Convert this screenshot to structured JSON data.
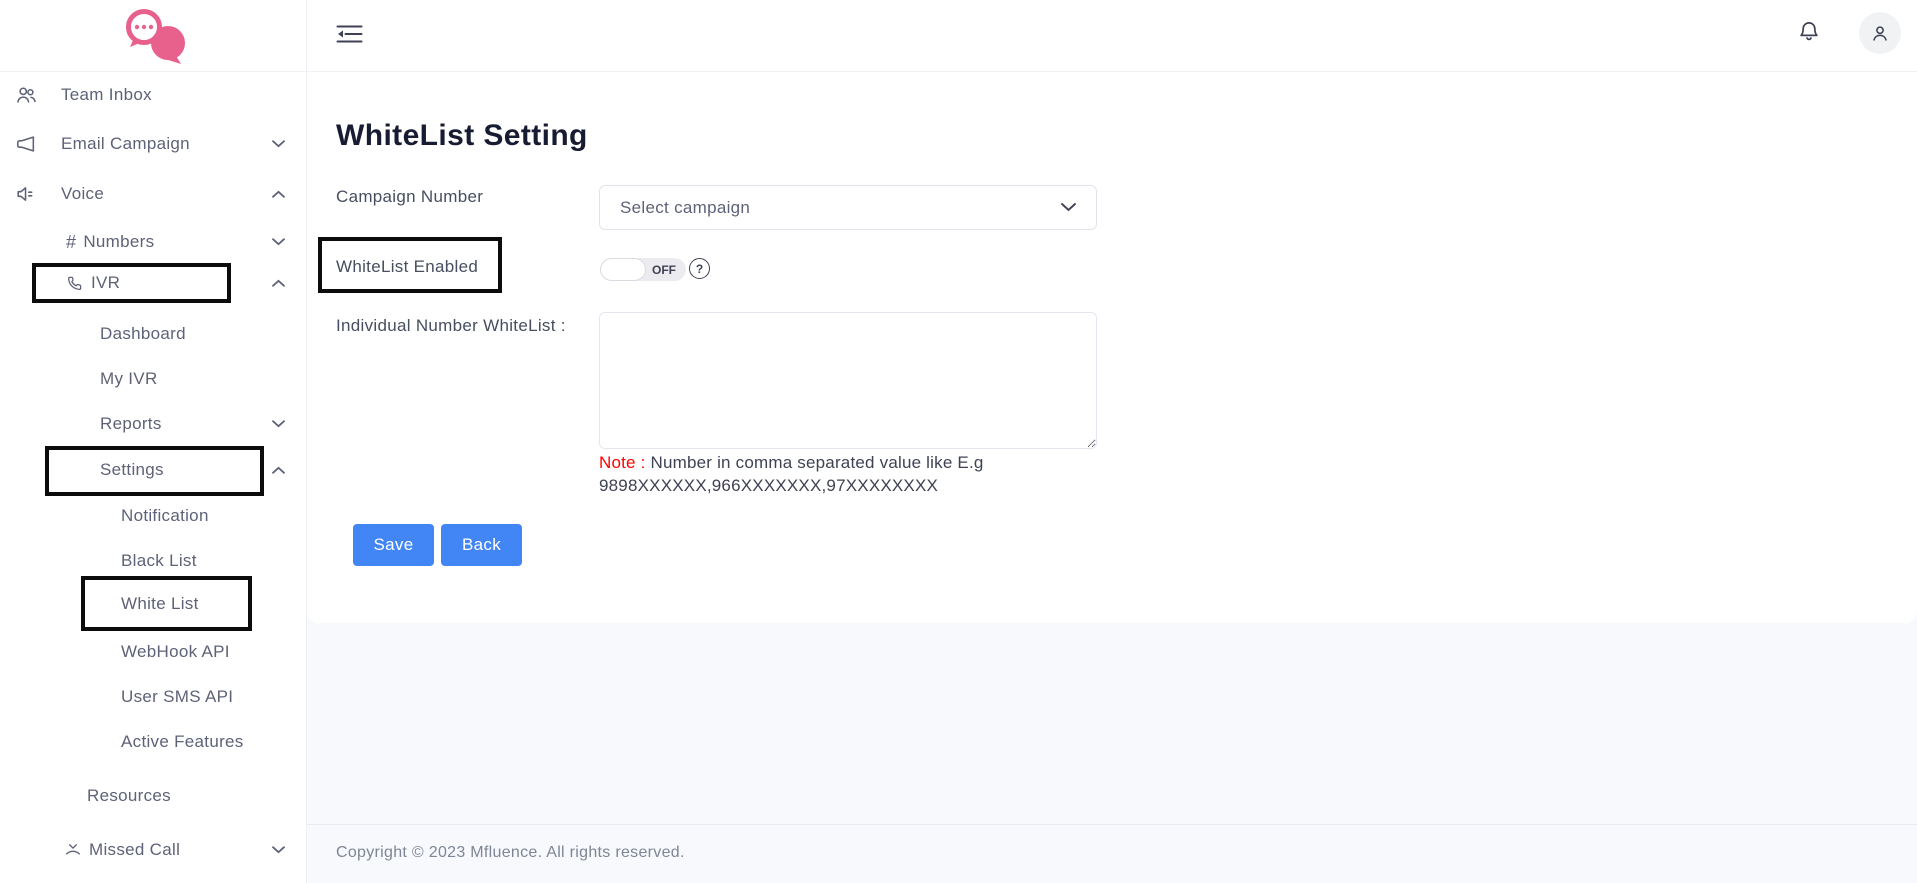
{
  "brand": {
    "logo": "chat-bubbles-logo",
    "accent_color": "#e8618c"
  },
  "header": {
    "menu_icon": "menu-fold-icon",
    "bell_icon": "bell-icon",
    "avatar_icon": "person-icon"
  },
  "sidebar": {
    "items": [
      {
        "label": "Team Inbox",
        "icon": "people-icon"
      },
      {
        "label": "Email Campaign",
        "icon": "megaphone-icon",
        "chevron": "down"
      },
      {
        "label": "Voice",
        "icon": "speaker-icon",
        "chevron": "up"
      },
      {
        "label": "Numbers",
        "icon": "hash-icon",
        "chevron": "down"
      },
      {
        "label": "IVR",
        "icon": "phone-icon",
        "chevron": "up",
        "highlighted": true
      },
      {
        "label": "Dashboard"
      },
      {
        "label": "My IVR"
      },
      {
        "label": "Reports",
        "chevron": "down"
      },
      {
        "label": "Settings",
        "chevron": "up",
        "highlighted": true
      },
      {
        "label": "Notification"
      },
      {
        "label": "Black List"
      },
      {
        "label": "White List",
        "highlighted": true
      },
      {
        "label": "WebHook API"
      },
      {
        "label": "User SMS API"
      },
      {
        "label": "Active Features"
      },
      {
        "label": "Resources"
      },
      {
        "label": "Missed Call",
        "icon": "missed-call-icon",
        "chevron": "down"
      }
    ]
  },
  "main": {
    "title": "WhiteList Setting",
    "campaign_label": "Campaign Number",
    "campaign_select_value": "Select campaign",
    "whitelist_enabled_label": "WhiteList Enabled",
    "toggle_state": "OFF",
    "individual_label": "Individual Number WhiteList :",
    "note_prefix": "Note :",
    "note_text": " Number in comma separated value like E.g",
    "note_example": "9898XXXXXX,966XXXXXXX,97XXXXXXXX",
    "save_label": "Save",
    "back_label": "Back",
    "button_color": "#4285f4",
    "note_color": "#ff0000"
  },
  "footer": {
    "copyright": "Copyright © 2023 Mfluence. All rights reserved."
  }
}
